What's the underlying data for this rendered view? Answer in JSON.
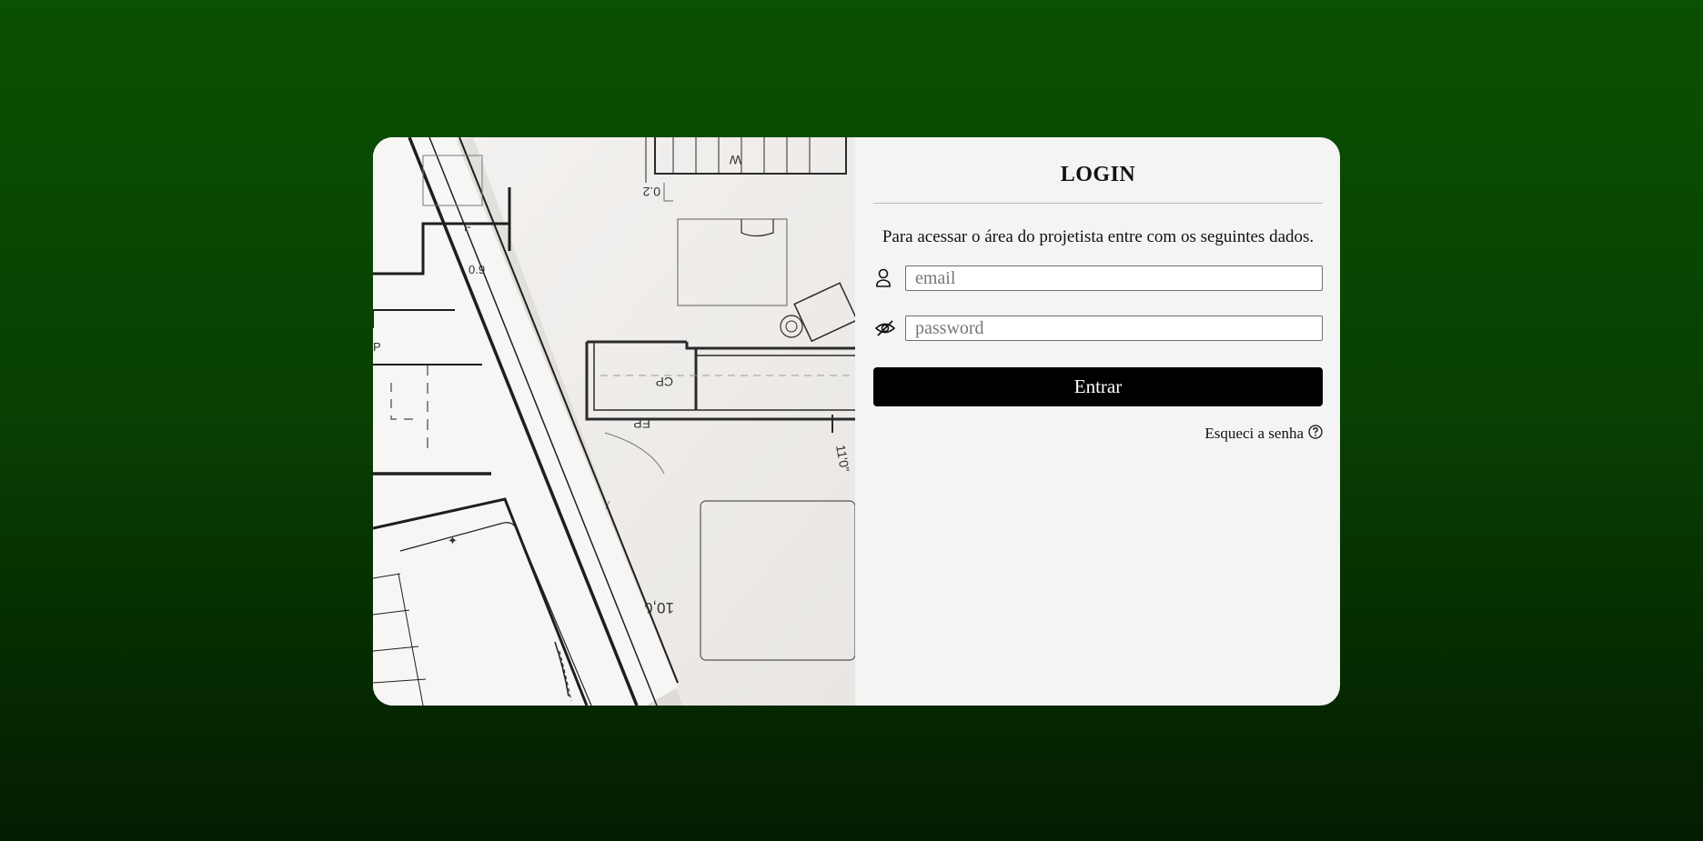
{
  "login": {
    "title": "LOGIN",
    "intro": "Para acessar o área do projetista entre com os seguintes dados.",
    "email": {
      "placeholder": "email",
      "value": "",
      "icon": "user-icon"
    },
    "password": {
      "placeholder": "password",
      "value": "",
      "icon": "eye-slash-icon"
    },
    "submit_label": "Entrar",
    "forgot_label": "Esqueci a senha",
    "forgot_icon": "question-circle-icon"
  },
  "illustration": {
    "subject": "architectural floor plan blueprint",
    "labels": [
      "CP",
      "EP",
      "11'0\"",
      "0.9",
      "10,01",
      "W"
    ]
  },
  "colors": {
    "background_top": "#0b5102",
    "background_bottom": "#031c00",
    "card": "#f4f4f4",
    "button": "#000000",
    "button_text": "#ffffff"
  }
}
